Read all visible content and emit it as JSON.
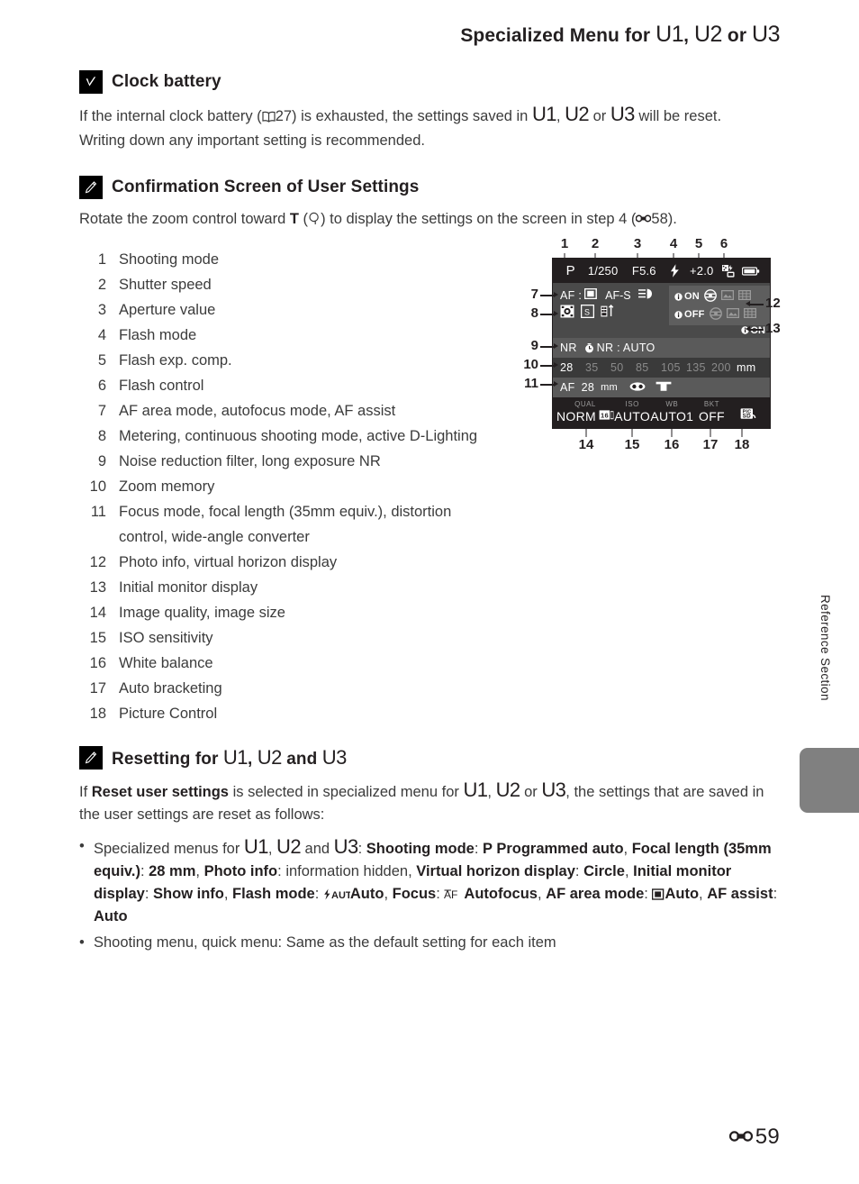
{
  "header": {
    "title_prefix": "Specialized Menu for ",
    "u1": "U1",
    "sep1": ", ",
    "u2": "U2",
    "sep2": " or ",
    "u3": "U3"
  },
  "sections": {
    "clock_battery": {
      "icon": "warning-check-icon",
      "title": "Clock battery",
      "line1_a": "If the internal clock battery (",
      "line1_ref": "27",
      "line1_b": ") is exhausted, the settings saved in ",
      "u1": "U1",
      "sep1": ", ",
      "u2": "U2",
      "sep2": " or ",
      "u3": "U3",
      "line1_c": " will be reset.",
      "line2": "Writing down any important setting is recommended."
    },
    "confirmation": {
      "icon": "pencil-note-icon",
      "title": "Confirmation Screen of User Settings",
      "intro_a": "Rotate the zoom control toward ",
      "intro_t": "T",
      "intro_b": " (",
      "intro_c": ") to display the settings on the screen in step 4 (",
      "intro_ref": "58",
      "intro_d": ")."
    },
    "resetting": {
      "icon": "pencil-note-icon",
      "title_a": "Resetting for ",
      "u1": "U1",
      "sep1": ", ",
      "u2": "U2",
      "sep2": " and ",
      "u3": "U3",
      "para_a": "If ",
      "para_bold": "Reset user settings",
      "para_b": " is selected in specialized menu for ",
      "para_c": ", the settings that are saved in the user settings are reset as follows:"
    }
  },
  "list": {
    "items": [
      {
        "n": "1",
        "text": "Shooting mode"
      },
      {
        "n": "2",
        "text": "Shutter speed"
      },
      {
        "n": "3",
        "text": "Aperture value"
      },
      {
        "n": "4",
        "text": "Flash mode"
      },
      {
        "n": "5",
        "text": "Flash exp. comp."
      },
      {
        "n": "6",
        "text": "Flash control"
      },
      {
        "n": "7",
        "text": "AF area mode, autofocus mode, AF assist"
      },
      {
        "n": "8",
        "text": "Metering, continuous shooting mode, active D-Lighting"
      },
      {
        "n": "9",
        "text": "Noise reduction filter, long exposure NR"
      },
      {
        "n": "10",
        "text": "Zoom memory"
      },
      {
        "n": "11",
        "text": "Focus mode, focal length (35mm equiv.), distortion control, wide-angle converter"
      },
      {
        "n": "12",
        "text": "Photo info, virtual horizon display"
      },
      {
        "n": "13",
        "text": "Initial monitor display"
      },
      {
        "n": "14",
        "text": "Image quality, image size"
      },
      {
        "n": "15",
        "text": "ISO sensitivity"
      },
      {
        "n": "16",
        "text": "White balance"
      },
      {
        "n": "17",
        "text": "Auto bracketing"
      },
      {
        "n": "18",
        "text": "Picture Control"
      }
    ]
  },
  "diagram": {
    "callouts_top": [
      "1",
      "2",
      "3",
      "4",
      "5",
      "6"
    ],
    "callouts_left": [
      "7",
      "8",
      "9",
      "10",
      "11"
    ],
    "callouts_right": [
      "12",
      "13"
    ],
    "callouts_bottom": [
      "14",
      "15",
      "16",
      "17",
      "18"
    ],
    "screen": {
      "top_row": {
        "shooting_mode": "P",
        "shutter_speed": "1/250",
        "aperture": "F5.6",
        "flash_mode_icon": "flash-icon",
        "flash_exp_comp": "+2.0",
        "flash_control_icon": "flash-control-icon",
        "battery_icon": "battery-icon"
      },
      "af_row": {
        "af_label": "AF :",
        "af_area_icon": "af-area-auto-icon",
        "autofocus_mode": "AF-S",
        "af_assist_icon": "af-assist-icon"
      },
      "metering_row": {
        "metering_icon": "matrix-metering-icon",
        "continuous_icon": "single-shot-icon",
        "d_lighting_icon": "active-d-lighting-icon"
      },
      "photo_info_panel": {
        "row1_label": "ON",
        "row2_label": "OFF",
        "horizon_icon": "virtual-horizon-icon",
        "photo_icon": "photo-info-icon",
        "grid_icon": "framing-grid-icon"
      },
      "initial_monitor": "ON",
      "nr_row": {
        "nr_label": "NR",
        "long_exposure_label": "NR :",
        "long_exposure_value": "AUTO"
      },
      "zoom_memory": {
        "values": [
          "28",
          "35",
          "50",
          "85",
          "105",
          "135",
          "200"
        ],
        "active": "28",
        "unit": "mm"
      },
      "focus_row": {
        "focus_mode": "AF",
        "focal_length": "28",
        "unit": "mm",
        "distortion_icon": "distortion-control-icon",
        "wide_converter_icon": "wide-angle-converter-icon"
      },
      "bottom_row": [
        {
          "sub": "QUAL",
          "val": "NORM",
          "icon": "image-size-icon"
        },
        {
          "sub": "ISO",
          "val": "AUTO",
          "icon": ""
        },
        {
          "sub": "WB",
          "val": "AUTO1",
          "icon": ""
        },
        {
          "sub": "BKT",
          "val": "OFF",
          "icon": ""
        },
        {
          "sub": "",
          "val": "",
          "icon": "picture-control-sd-icon"
        }
      ]
    }
  },
  "reset_bullets": {
    "b1": {
      "lead": "Specialized menus for ",
      "u1": "U1",
      "sep1": ", ",
      "u2": "U2",
      "sep2": " and ",
      "u3": "U3",
      "colon": ": ",
      "k_shooting": "Shooting mode",
      "v_shooting": " Programmed auto",
      "k_focal": "Focal length (35mm equiv.)",
      "v_focal": "28 mm",
      "k_photoinfo": "Photo info",
      "v_photoinfo": "information hidden",
      "k_horizon": "Virtual horizon display",
      "v_horizon": "Circle",
      "k_initial": "Initial monitor display",
      "v_initial": "Show info",
      "k_flash": "Flash mode",
      "v_flash": "Auto",
      "k_focus": "Focus",
      "v_focus": "Autofocus",
      "k_afarea": "AF area mode",
      "v_afarea": "Auto",
      "k_afassist": "AF assist",
      "v_afassist": "Auto"
    },
    "b2": "Shooting menu, quick menu: Same as the default setting for each item"
  },
  "side": {
    "label": "Reference Section"
  },
  "footer": {
    "page_number": "59",
    "symbol": "E-mark-icon"
  },
  "colors": {
    "text": "#231f20",
    "body_text": "#3b3b3b",
    "screen_bg": "#231f20",
    "screen_mid": "#4a4a4a",
    "panel": "#5e5e5e",
    "tab_gray": "#808080"
  }
}
